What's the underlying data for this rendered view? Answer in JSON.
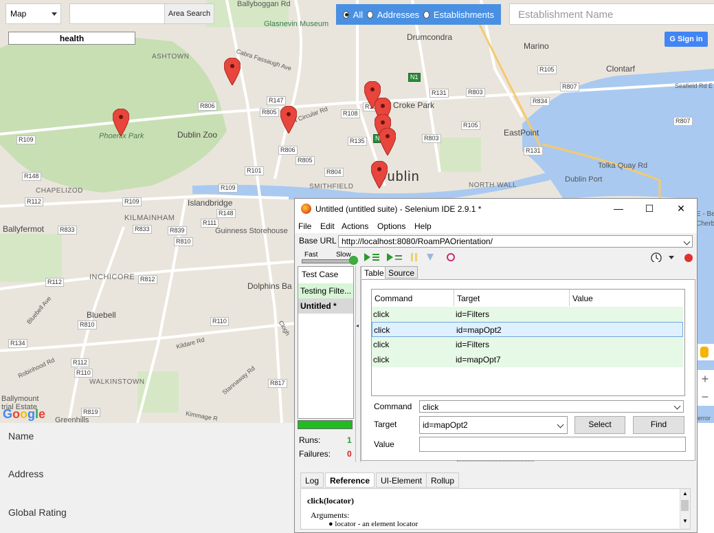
{
  "map": {
    "type_select": "Map",
    "area_search_btn": "Area Search",
    "health_label": "health",
    "radio_all": "All",
    "radio_addresses": "Addresses",
    "radio_establishments": "Establishments",
    "establishment_placeholder": "Establishment Name",
    "signin": "Sign in",
    "google": "Google",
    "labels": {
      "ballyboggan": "Ballyboggan Rd",
      "glasnevin": "Glasnevin Museum",
      "drumcondra": "Drumcondra",
      "marino": "Marino",
      "clontarf": "Clontarf",
      "ashtown": "ASHTOWN",
      "cabra": "Cabra Fassaugh Ave",
      "phoenix": "Phoenix Park",
      "dublinzoo": "Dublin Zoo",
      "ncircular": "N Circular Rd",
      "crokepark": "Croke Park",
      "eastpoint": "EastPoint",
      "seafield": "Seafield Rd E",
      "tolka": "Tolka Quay Rd",
      "dublinport": "Dublin Port",
      "dublin": "Dublin",
      "smithfield": "SMITHFIELD",
      "northwall": "NORTH WALL",
      "chapelizod": "CHAPELIZOD",
      "islandbridge": "Islandbridge",
      "ballyfermot": "Ballyfermot",
      "kilmainham": "KILMAINHAM",
      "guinness": "Guinness Storehouse",
      "inchicore": "INCHICORE",
      "dolphins": "Dolphins Ba",
      "bluebell": "Bluebell",
      "bluebellave": "Bluebell Ave",
      "kildare": "Kildare Rd",
      "robinhood": "Robinhood Rd",
      "walkinstown": "WALKINSTOWN",
      "stannaway": "Stannaway Rd",
      "ballymount": "Ballymount",
      "trialestate": "trial Estate",
      "greenhills": "Greenhills",
      "kimmage": "Kimmage R",
      "clogher": "Clogh",
      "error": "error",
      "cherb": "Cherb",
      "be": "E - Be"
    },
    "roads": [
      "R105",
      "R807",
      "R834",
      "R131",
      "R803",
      "R147",
      "R806",
      "R805",
      "R108",
      "R135",
      "R803",
      "R105",
      "R807",
      "R109",
      "R806",
      "R805",
      "R101",
      "R804",
      "R148",
      "R112",
      "R109",
      "R109",
      "R148",
      "R833",
      "R833",
      "R839",
      "R111",
      "R810",
      "R812",
      "R112",
      "R110",
      "R810",
      "R134",
      "R112",
      "R110",
      "R817",
      "R819",
      "R131",
      "R102",
      "N1",
      "N1"
    ]
  },
  "below": {
    "name_label": "Name",
    "address_label": "Address",
    "rating_label": "Global Rating"
  },
  "selenium": {
    "title": "Untitled (untitled suite) - Selenium IDE 2.9.1 *",
    "menu": [
      "File",
      "Edit",
      "Actions",
      "Options",
      "Help"
    ],
    "base_url_label": "Base URL",
    "base_url": "http://localhost:8080/RoamPAOrientation/",
    "fast": "Fast",
    "slow": "Slow",
    "test_case_header": "Test Case",
    "test_cases": [
      "Testing Filte...",
      "Untitled *"
    ],
    "runs_label": "Runs:",
    "runs_value": "1",
    "failures_label": "Failures:",
    "failures_value": "0",
    "tab_table": "Table",
    "tab_source": "Source",
    "col_command": "Command",
    "col_target": "Target",
    "col_value": "Value",
    "rows": [
      {
        "command": "click",
        "target": "id=Filters",
        "value": ""
      },
      {
        "command": "click",
        "target": "id=mapOpt2",
        "value": ""
      },
      {
        "command": "click",
        "target": "id=Filters",
        "value": ""
      },
      {
        "command": "click",
        "target": "id=mapOpt7",
        "value": ""
      }
    ],
    "command_label": "Command",
    "command_value": "click",
    "target_label": "Target",
    "target_value": "id=mapOpt2",
    "value_label": "Value",
    "value_value": "",
    "select_btn": "Select",
    "find_btn": "Find",
    "bottom_tabs": [
      "Log",
      "Reference",
      "UI-Element",
      "Rollup"
    ],
    "ref_title": "click(locator)",
    "ref_args": "Arguments:",
    "ref_item": "locator - an element locator"
  },
  "colors": {
    "park": "#c8dfb4",
    "water": "#a9c9f0",
    "accent": "#4a90e2",
    "pin": "#e8453c"
  }
}
